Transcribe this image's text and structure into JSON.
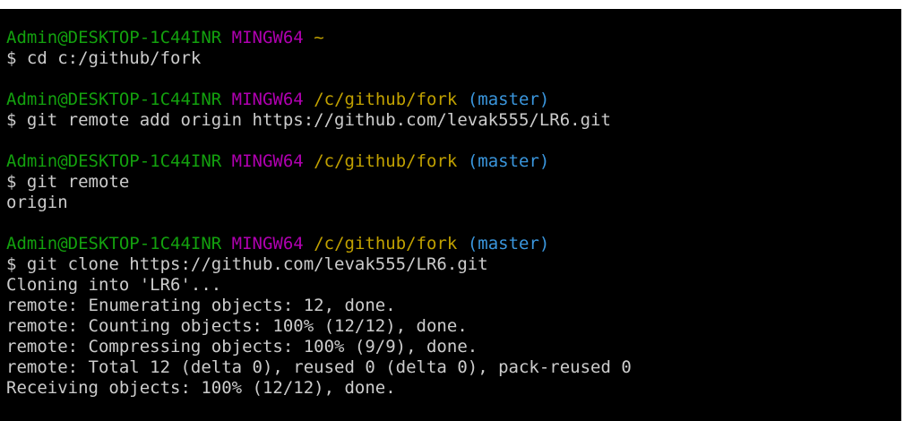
{
  "colors": {
    "background": "#000000",
    "user_host": "#13a10e",
    "shell_name": "#b000b0",
    "path": "#c1a100",
    "branch": "#3a96dd",
    "text": "#cccccc"
  },
  "blocks": [
    {
      "prompt": {
        "user_host": "Admin@DESKTOP-1C44INR",
        "shell": "MINGW64",
        "path": "~",
        "branch": ""
      },
      "command": "$ cd c:/github/fork",
      "output": []
    },
    {
      "prompt": {
        "user_host": "Admin@DESKTOP-1C44INR",
        "shell": "MINGW64",
        "path": "/c/github/fork",
        "branch": "(master)"
      },
      "command": "$ git remote add origin https://github.com/levak555/LR6.git",
      "output": []
    },
    {
      "prompt": {
        "user_host": "Admin@DESKTOP-1C44INR",
        "shell": "MINGW64",
        "path": "/c/github/fork",
        "branch": "(master)"
      },
      "command": "$ git remote",
      "output": [
        "origin"
      ]
    },
    {
      "prompt": {
        "user_host": "Admin@DESKTOP-1C44INR",
        "shell": "MINGW64",
        "path": "/c/github/fork",
        "branch": "(master)"
      },
      "command": "$ git clone https://github.com/levak555/LR6.git",
      "output": [
        "Cloning into 'LR6'...",
        "remote: Enumerating objects: 12, done.",
        "remote: Counting objects: 100% (12/12), done.",
        "remote: Compressing objects: 100% (9/9), done.",
        "remote: Total 12 (delta 0), reused 0 (delta 0), pack-reused 0",
        "Receiving objects: 100% (12/12), done."
      ]
    }
  ]
}
